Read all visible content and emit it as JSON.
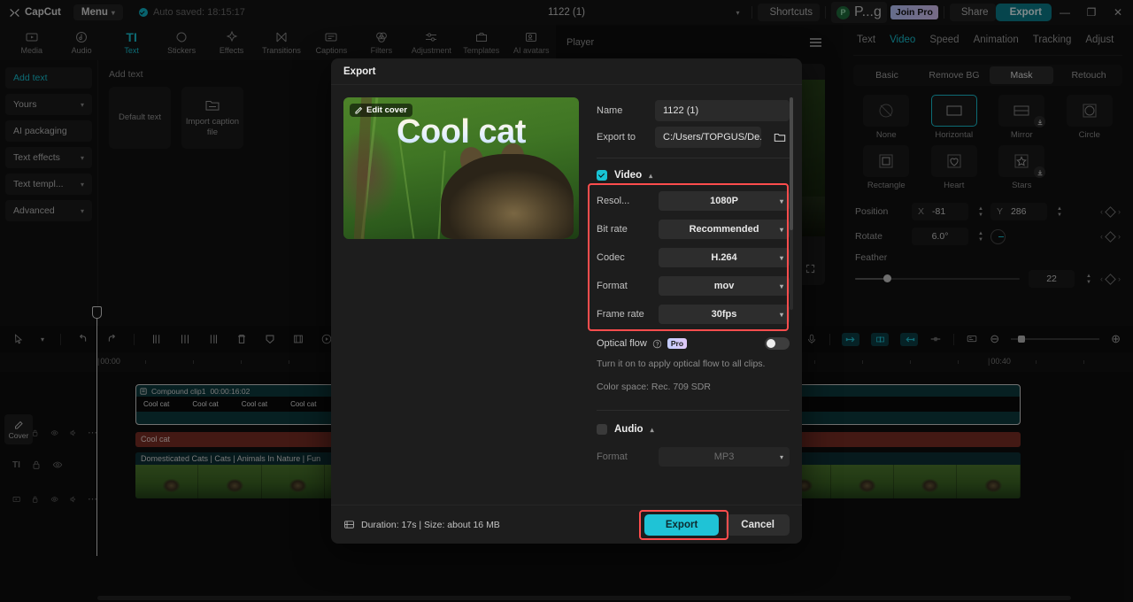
{
  "titlebar": {
    "app_name": "CapCut",
    "menu_label": "Menu",
    "autosave": "Auto saved: 18:15:17",
    "project_title": "1122 (1)",
    "shortcuts_label": "Shortcuts",
    "account_label": "P...g",
    "account_initial": "P",
    "join_pro_label": "Join Pro",
    "share_label": "Share",
    "export_label": "Export",
    "minimize": "—",
    "maximize": "❐",
    "close": "✕"
  },
  "function_tabs": [
    {
      "label": "Media",
      "icon": "media-icon",
      "active": false
    },
    {
      "label": "Audio",
      "icon": "audio-icon",
      "active": false
    },
    {
      "label": "Text",
      "icon": "text-icon",
      "active": true
    },
    {
      "label": "Stickers",
      "icon": "stickers-icon",
      "active": false
    },
    {
      "label": "Effects",
      "icon": "effects-icon",
      "active": false
    },
    {
      "label": "Transitions",
      "icon": "transitions-icon",
      "active": false
    },
    {
      "label": "Captions",
      "icon": "captions-icon",
      "active": false
    },
    {
      "label": "Filters",
      "icon": "filters-icon",
      "active": false
    },
    {
      "label": "Adjustment",
      "icon": "adjustment-icon",
      "active": false
    },
    {
      "label": "Templates",
      "icon": "templates-icon",
      "active": false
    },
    {
      "label": "AI avatars",
      "icon": "ai-avatars-icon",
      "active": false
    }
  ],
  "left_panel": {
    "categories": [
      {
        "label": "Add text",
        "expandable": false,
        "active": true
      },
      {
        "label": "Yours",
        "expandable": true,
        "active": false
      },
      {
        "label": "AI packaging",
        "expandable": false,
        "active": false
      },
      {
        "label": "Text effects",
        "expandable": true,
        "active": false
      },
      {
        "label": "Text templ...",
        "expandable": true,
        "active": false
      },
      {
        "label": "Advanced",
        "expandable": true,
        "active": false
      }
    ],
    "section_title": "Add text",
    "assets": [
      {
        "label": "Default text",
        "icon": "text-asset-icon"
      },
      {
        "label": "Import caption file",
        "icon": "folder-icon"
      }
    ]
  },
  "player": {
    "title": "Player",
    "menu_icon": "hamburger-icon"
  },
  "right_panel": {
    "tabs": [
      {
        "label": "Text",
        "active": false
      },
      {
        "label": "Video",
        "active": true
      },
      {
        "label": "Speed",
        "active": false
      },
      {
        "label": "Animation",
        "active": false
      },
      {
        "label": "Tracking",
        "active": false
      },
      {
        "label": "Adjust",
        "active": false
      }
    ],
    "subtabs": [
      {
        "label": "Basic",
        "active": false
      },
      {
        "label": "Remove BG",
        "active": false
      },
      {
        "label": "Mask",
        "active": true
      },
      {
        "label": "Retouch",
        "active": false
      }
    ],
    "masks": [
      {
        "label": "None",
        "icon": "mask-none-icon",
        "selected": false,
        "download": false
      },
      {
        "label": "Horizontal",
        "icon": "mask-horizontal-icon",
        "selected": true,
        "download": false
      },
      {
        "label": "Mirror",
        "icon": "mask-mirror-icon",
        "selected": false,
        "download": true
      },
      {
        "label": "Circle",
        "icon": "mask-circle-icon",
        "selected": false,
        "download": false
      },
      {
        "label": "Rectangle",
        "icon": "mask-rectangle-icon",
        "selected": false,
        "download": false
      },
      {
        "label": "Heart",
        "icon": "mask-heart-icon",
        "selected": false,
        "download": false
      },
      {
        "label": "Stars",
        "icon": "mask-stars-icon",
        "selected": false,
        "download": true
      }
    ],
    "position": {
      "label": "Position",
      "x_axis": "X",
      "x_value": "-81",
      "y_axis": "Y",
      "y_value": "286"
    },
    "rotate": {
      "label": "Rotate",
      "value": "6.0°"
    },
    "feather": {
      "label": "Feather",
      "value": "22"
    }
  },
  "timeline": {
    "tools": [
      {
        "name": "select-tool",
        "icon": "cursor-icon"
      },
      {
        "name": "undo",
        "icon": "undo-icon"
      },
      {
        "name": "redo",
        "icon": "redo-icon"
      },
      {
        "name": "split-left",
        "icon": "split-left-icon"
      },
      {
        "name": "split",
        "icon": "split-icon"
      },
      {
        "name": "split-right",
        "icon": "split-right-icon"
      },
      {
        "name": "delete",
        "icon": "trash-icon"
      },
      {
        "name": "mask",
        "icon": "shield-icon"
      },
      {
        "name": "crop",
        "icon": "crop-icon"
      },
      {
        "name": "freeze",
        "icon": "freeze-icon"
      },
      {
        "name": "mirror",
        "icon": "mirror-icon"
      }
    ],
    "right_tools": [
      {
        "name": "record",
        "icon": "microphone-icon"
      },
      {
        "name": "auto-cut-in",
        "icon": "cut-in-icon"
      },
      {
        "name": "auto-cut-mid",
        "icon": "cut-mid-icon"
      },
      {
        "name": "auto-cut-out",
        "icon": "cut-out-icon"
      },
      {
        "name": "adjust-duration",
        "icon": "duration-icon"
      },
      {
        "name": "keyframe-view",
        "icon": "keyframe-icon"
      }
    ],
    "ruler_labels": [
      "00:00",
      "00:40"
    ],
    "zoom_out": "⊖",
    "zoom_in": "⊕",
    "clips": {
      "compound": {
        "title": "Compound clip1",
        "duration": "00:00:16:02",
        "caption_repeat": "Cool cat",
        "caption_count": 6
      },
      "text": {
        "label": "Cool cat"
      },
      "video": {
        "label": "Domesticated Cats | Cats | Animals In Nature | Fun"
      }
    },
    "cover_button": "Cover"
  },
  "export_dialog": {
    "title": "Export",
    "edit_cover_label": "Edit cover",
    "cover_title": "Cool cat",
    "name_label": "Name",
    "name_value": "1122 (1)",
    "export_to_label": "Export to",
    "export_to_value": "C:/Users/TOPGUS/De...",
    "video_section": {
      "label": "Video",
      "checked": true,
      "settings": [
        {
          "label": "Resol...",
          "value": "1080P"
        },
        {
          "label": "Bit rate",
          "value": "Recommended"
        },
        {
          "label": "Codec",
          "value": "H.264"
        },
        {
          "label": "Format",
          "value": "mov"
        },
        {
          "label": "Frame rate",
          "value": "30fps"
        }
      ]
    },
    "optical_flow": {
      "label": "Optical flow",
      "pro_badge": "Pro",
      "enabled": false,
      "hint": "Turn it on to apply optical flow to all clips."
    },
    "color_space": "Color space: Rec. 709 SDR",
    "audio_section": {
      "label": "Audio",
      "checked": false,
      "settings": [
        {
          "label": "Format",
          "value": "MP3"
        }
      ]
    },
    "footer": {
      "duration_info": "Duration: 17s | Size: about 16 MB",
      "export_button": "Export",
      "cancel_button": "Cancel"
    },
    "highlight_color": "#ff4d4d"
  }
}
